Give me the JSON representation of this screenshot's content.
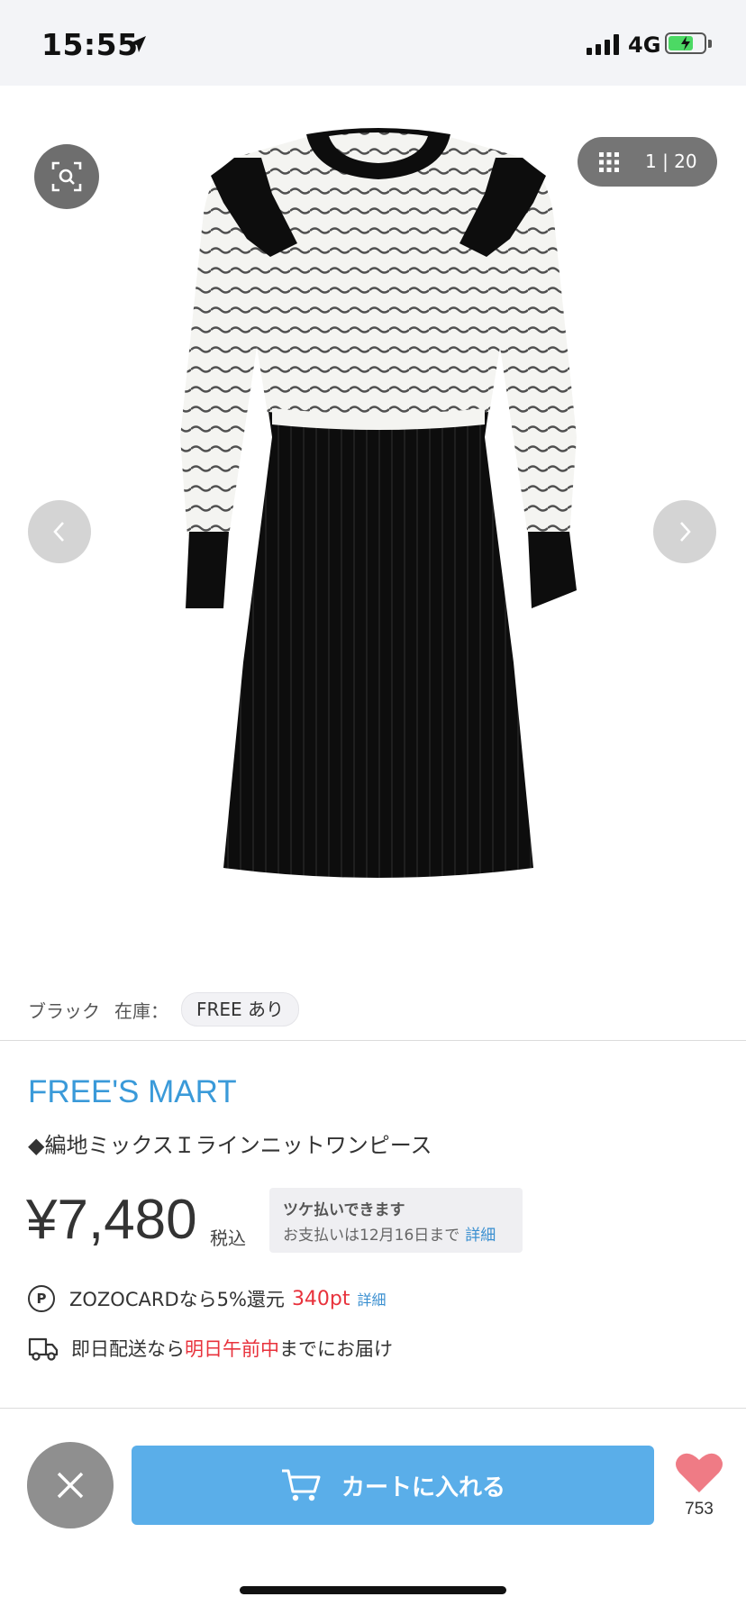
{
  "status_bar": {
    "time": "15:55",
    "network": "4G",
    "battery_level": 0.7
  },
  "gallery": {
    "counter": "1 | 20",
    "current_image": 1,
    "total_images": 20
  },
  "variant": {
    "color": "ブラック",
    "stock_label": "在庫：",
    "stock_chip": "FREE あり"
  },
  "product": {
    "brand": "FREE'S MART",
    "name": "◆編地ミックスＩラインニットワンピース",
    "price": "¥7,480",
    "tax_label": "税込"
  },
  "tsuke": {
    "title": "ツケ払いできます",
    "subtitle": "お支払いは12月16日まで",
    "link": "詳細"
  },
  "points": {
    "icon_label": "P",
    "text": "ZOZOCARDなら5%還元",
    "points": "340pt",
    "link": "詳細"
  },
  "delivery": {
    "prefix": "即日配送なら",
    "highlight": "明日午前中",
    "suffix": "までにお届け"
  },
  "bottom_bar": {
    "cart_label": "カートに入れる",
    "favorite_count": "753"
  },
  "colors": {
    "brand_blue": "#3a9ad9",
    "cart_blue": "#5aaee9",
    "heart_pink": "#ef7b85",
    "accent_red": "#e8323c"
  }
}
